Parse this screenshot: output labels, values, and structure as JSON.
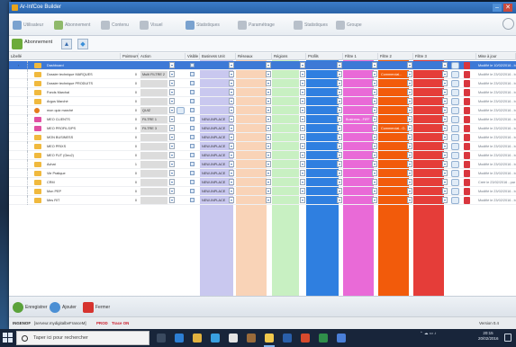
{
  "window": {
    "title": "Ar-InfCoe Builder",
    "minimize": "–",
    "close": "✕"
  },
  "toolbar": {
    "items": [
      {
        "label": "Utilisateur",
        "icon": "users-icon"
      },
      {
        "label": "Abonnement",
        "icon": "subscription-icon"
      },
      {
        "label": "Contenu",
        "icon": "document-icon"
      },
      {
        "label": "Visuel",
        "icon": "image-icon"
      },
      {
        "label": "Statistiques",
        "icon": "stats-icon"
      },
      {
        "label": "Paramétrage",
        "icon": "settings-icon"
      },
      {
        "label": "Statistiques",
        "icon": "chart-icon"
      },
      {
        "label": "Groupe",
        "icon": "refresh-icon"
      }
    ]
  },
  "subbar": {
    "label": "Abonnement",
    "up": "▲",
    "drop": "◆"
  },
  "grid": {
    "columns": [
      "Libellé",
      "Pointeurs",
      "Action",
      "Visible",
      "Business Unit",
      "Réseaux",
      "Régions",
      "Profils",
      "Filtre 1",
      "Filtre 2",
      "Filtre 3",
      "Mise à jour"
    ],
    "rows": [
      {
        "name": "Dashboard",
        "count": "",
        "action": "",
        "visible": true,
        "bu": "",
        "filtre1": "",
        "filtre2": "",
        "maj": "Modifié le 10/02/2016 - bo",
        "icon": "folder-icon",
        "selected": true
      },
      {
        "name": "Dossier technique MARQUES",
        "count": "0",
        "action": "Multi FILTRE 2",
        "visible": true,
        "bu": "",
        "filtre1": "",
        "filtre2": "Commercial...",
        "maj": "Modifié le 23/02/2016 - bo",
        "icon": "folder-icon",
        "selected": false
      },
      {
        "name": "Dossier technique PRODUITS",
        "count": "0",
        "action": "",
        "visible": true,
        "bu": "",
        "filtre1": "",
        "filtre2": "",
        "maj": "Modifié le 23/02/2016 - bo",
        "icon": "folder-icon",
        "selected": false
      },
      {
        "name": "Fonds Marchal",
        "count": "0",
        "action": "",
        "visible": true,
        "bu": "",
        "filtre1": "",
        "filtre2": "",
        "maj": "Modifié le 23/02/2016 - bo",
        "icon": "folder-icon",
        "selected": false
      },
      {
        "name": "Argus Marché",
        "count": "0",
        "action": "",
        "visible": true,
        "bu": "",
        "filtre1": "",
        "filtre2": "",
        "maj": "Modifié le 23/02/2016 - bo",
        "icon": "folder-icon",
        "selected": false
      },
      {
        "name": "mon quiz marché",
        "count": "0",
        "action": "QUIZ",
        "visible": true,
        "bu": "",
        "filtre1": "",
        "filtre2": "",
        "maj": "Modifié le 23/02/2016 - bo",
        "icon": "quiz-icon",
        "selected": false
      },
      {
        "name": "MEO CLIENTS",
        "count": "0",
        "action": "FILTRE 1",
        "visible": true,
        "bu": "NEW-INPLACE",
        "filtre1": "Business...FIFF",
        "filtre2": "",
        "maj": "Modifié le 23/02/2016 - bo",
        "icon": "folder-icon",
        "selected": false
      },
      {
        "name": "MEO PROFILS/PS",
        "count": "0",
        "action": "FILTRE 3",
        "visible": true,
        "bu": "NEW-INPLACE",
        "filtre1": "",
        "filtre2": "Commercial...O...",
        "maj": "Modifié le 23/02/2016 - bo",
        "icon": "folder-icon",
        "selected": false
      },
      {
        "name": "MON BUSINESS",
        "count": "0",
        "action": "",
        "visible": true,
        "bu": "NEW-INPLACE",
        "filtre1": "",
        "filtre2": "",
        "maj": "Modifié le 23/02/2016 - bo",
        "icon": "folder-icon",
        "selected": false
      },
      {
        "name": "MEO PRIXS",
        "count": "0",
        "action": "",
        "visible": true,
        "bu": "NEW-INPLACE",
        "filtre1": "",
        "filtre2": "",
        "maj": "Modifié le 23/02/2016 - bo",
        "icon": "folder-icon",
        "selected": false
      },
      {
        "name": "MEO FUT (Geo2)",
        "count": "0",
        "action": "",
        "visible": true,
        "bu": "NEW-INPLACE",
        "filtre1": "",
        "filtre2": "",
        "maj": "Modifié le 23/02/2016 - bo",
        "icon": "folder-icon",
        "selected": false
      },
      {
        "name": "Achat",
        "count": "1",
        "action": "",
        "visible": true,
        "bu": "NEW-INPLACE",
        "filtre1": "",
        "filtre2": "",
        "maj": "Modifié le 23/02/2016 - bo",
        "icon": "folder-icon",
        "selected": false
      },
      {
        "name": "Vie Pratique",
        "count": "0",
        "action": "",
        "visible": true,
        "bu": "NEW-INPLACE",
        "filtre1": "",
        "filtre2": "",
        "maj": "Modifié le 23/02/2016 - bo",
        "icon": "folder-icon",
        "selected": false
      },
      {
        "name": "CRM",
        "count": "0",
        "action": "",
        "visible": true,
        "bu": "NEW-INPLACE",
        "filtre1": "",
        "filtre2": "",
        "maj": "Créé le 23/02/2016 - par ti",
        "icon": "folder-icon",
        "selected": false
      },
      {
        "name": "Mon PEP",
        "count": "0",
        "action": "",
        "visible": true,
        "bu": "NEW-INPLACE",
        "filtre1": "",
        "filtre2": "",
        "maj": "Modifié le 23/02/2016 - bo",
        "icon": "folder-icon",
        "selected": false
      },
      {
        "name": "Mes RIT",
        "count": "0",
        "action": "",
        "visible": true,
        "bu": "NEW-INPLACE",
        "filtre1": "",
        "filtre2": "",
        "maj": "Modifié le 23/02/2016 - bo",
        "icon": "folder-icon",
        "selected": false
      }
    ]
  },
  "bottom": {
    "save": "Enregistrer",
    "add": "Ajouter",
    "close": "Fermer"
  },
  "status": {
    "user": "INGENOF",
    "path": "[serveur.mydigitalbeFranceM]",
    "badge1": "PROD",
    "badge2": "Trace ON",
    "version": "Version 0.4"
  },
  "taskbar": {
    "search_placeholder": "Taper ici pour rechercher",
    "time": "20:15",
    "date": "20/02/2016"
  },
  "colors": {
    "bu_col": "#c9c8ef",
    "reseaux_col": "#f9d3b7",
    "regions_col": "#c8f0c2",
    "profils_col": "#2f7fe0",
    "filtre1_col": "#e96ad7",
    "filtre2_col": "#f25b0b",
    "filtre3_col": "#e53d39",
    "selection": "#3d79d6"
  }
}
